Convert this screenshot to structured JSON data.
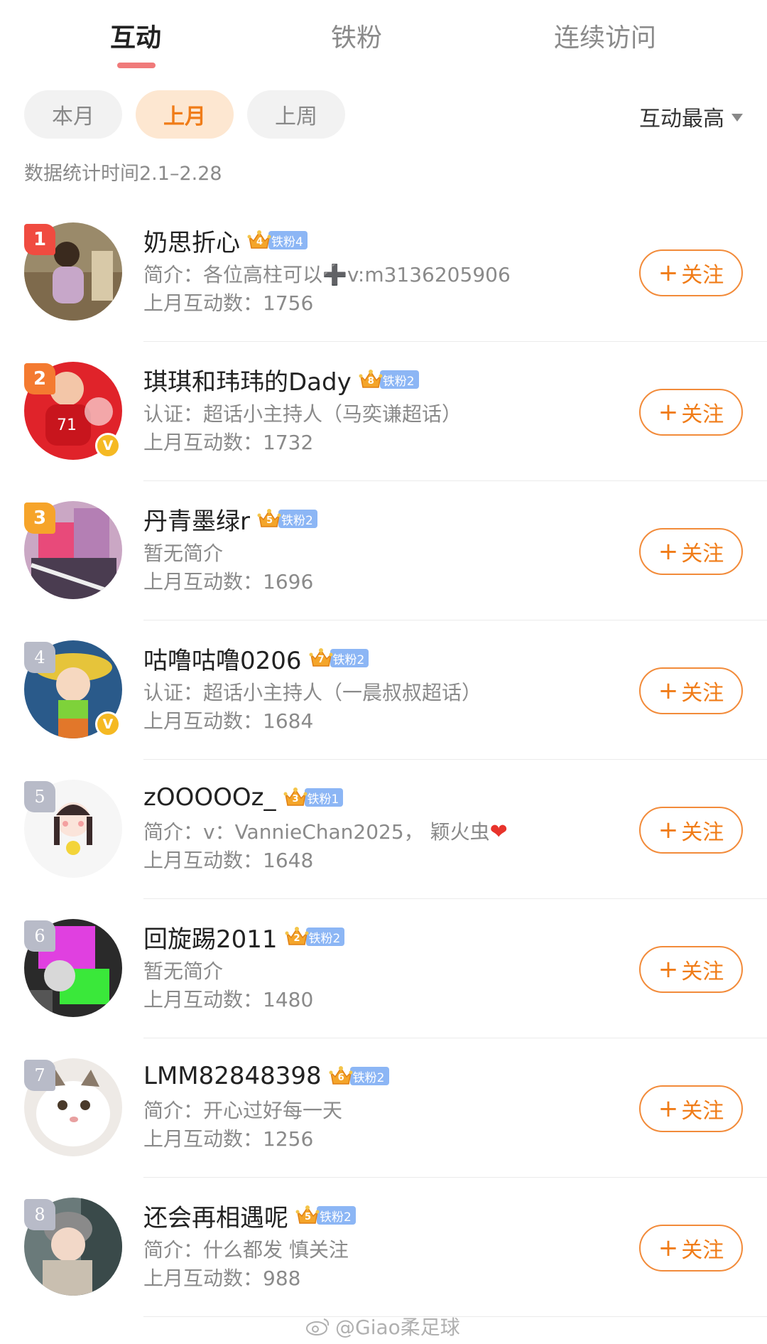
{
  "tabs": [
    {
      "label": "互动",
      "active": true
    },
    {
      "label": "铁粉",
      "active": false
    },
    {
      "label": "连续访问",
      "active": false
    }
  ],
  "filters": [
    {
      "label": "本月",
      "active": false
    },
    {
      "label": "上月",
      "active": true
    },
    {
      "label": "上周",
      "active": false
    }
  ],
  "sort_label": "互动最高",
  "stat_time": "数据统计时间2.1–2.28",
  "follow_label": "关注",
  "colors": {
    "accent": "#f07c18",
    "tab_indicator": "#f07a7a",
    "fan_badge": "#8cb6f5"
  },
  "users": [
    {
      "rank": "1",
      "name": "奶思折心",
      "crown_level": "4",
      "fan_label": "铁粉4",
      "desc": "简介：各位高柱可以➕v:m3136205906",
      "count": "上月互动数：1756",
      "verified": false,
      "rank_color": "#f04b40"
    },
    {
      "rank": "2",
      "name": "琪琪和玮玮的Dady",
      "crown_level": "8",
      "fan_label": "铁粉2",
      "desc": "认证：超话小主持人（马奕谦超话）",
      "count": "上月互动数：1732",
      "verified": true,
      "rank_color": "#f47a30"
    },
    {
      "rank": "3",
      "name": "丹青墨绿r",
      "crown_level": "5",
      "fan_label": "铁粉2",
      "desc": "暂无简介",
      "count": "上月互动数：1696",
      "verified": false,
      "rank_color": "#f6a42a"
    },
    {
      "rank": "4",
      "name": "咕噜咕噜0206",
      "crown_level": "7",
      "fan_label": "铁粉2",
      "desc": "认证：超话小主持人（一晨叔叔超话）",
      "count": "上月互动数：1684",
      "verified": true,
      "rank_color": "gray"
    },
    {
      "rank": "5",
      "name": "zOOOOOz_",
      "crown_level": "3",
      "fan_label": "铁粉1",
      "desc": "简介：v：VannieChan2025，  颖火虫",
      "heart": true,
      "count": "上月互动数：1648",
      "verified": false,
      "rank_color": "gray"
    },
    {
      "rank": "6",
      "name": "回旋踢2011",
      "crown_level": "2",
      "fan_label": "铁粉2",
      "desc": "暂无简介",
      "count": "上月互动数：1480",
      "verified": false,
      "rank_color": "gray"
    },
    {
      "rank": "7",
      "name": "LMM82848398",
      "crown_level": "6",
      "fan_label": "铁粉2",
      "desc": "简介：开心过好每一天",
      "count": "上月互动数：1256",
      "verified": false,
      "rank_color": "gray"
    },
    {
      "rank": "8",
      "name": "还会再相遇呢",
      "crown_level": "5",
      "fan_label": "铁粉2",
      "desc": "简介：什么都发 慎关注",
      "count": "上月互动数：988",
      "verified": false,
      "rank_color": "gray"
    }
  ],
  "watermark": "@Giao柔足球"
}
